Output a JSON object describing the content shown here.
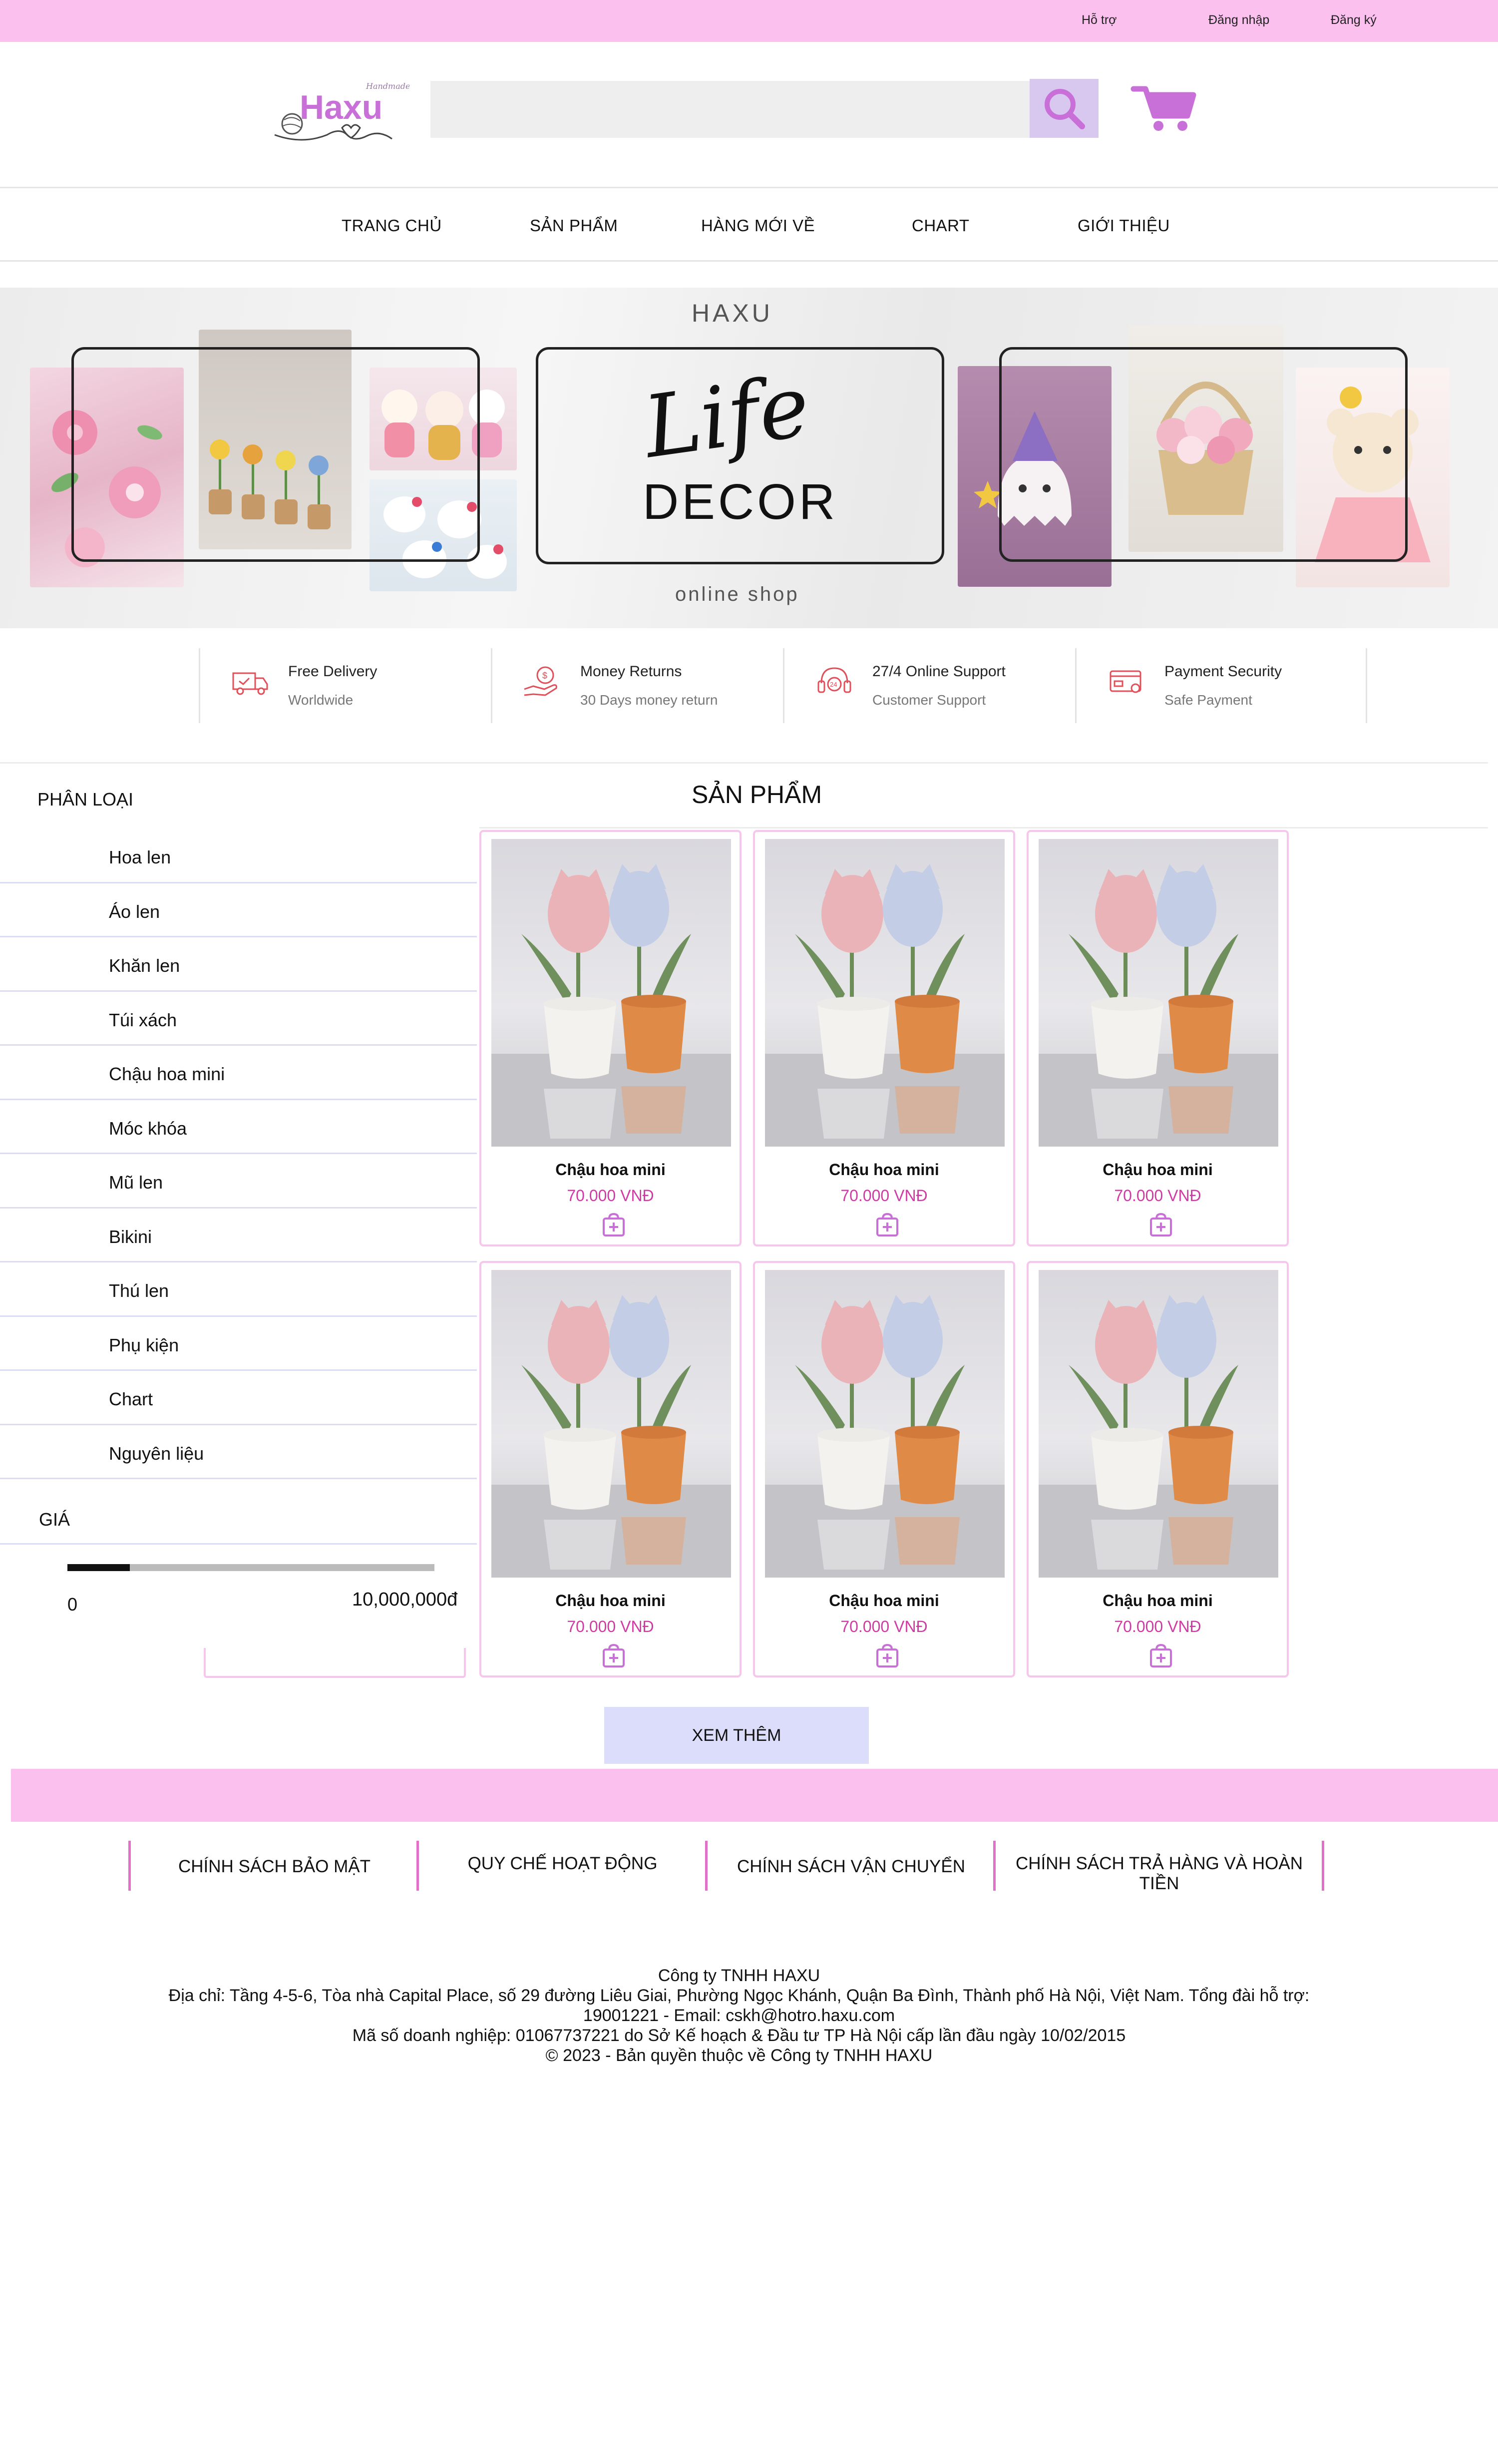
{
  "topbar": {
    "support": "Hỗ trợ",
    "login": "Đăng nhập",
    "register": "Đăng ký"
  },
  "header": {
    "logo_text": "Haxu",
    "logo_script": "Handmade",
    "search_placeholder": ""
  },
  "nav": {
    "items": [
      "TRANG CHỦ",
      "SẢN PHẨM",
      "HÀNG MỚI VỀ",
      "CHART",
      "GIỚI THIỆU"
    ]
  },
  "banner": {
    "brand": "HAXU",
    "headline_script": "Life",
    "headline": "DECOR",
    "tagline": "online shop"
  },
  "features": [
    {
      "title": "Free Delivery",
      "subtitle": "Worldwide",
      "icon": "truck-icon"
    },
    {
      "title": "Money Returns",
      "subtitle": "30 Days money return",
      "icon": "money-hand-icon"
    },
    {
      "title": "27/4 Online Support",
      "subtitle": "Customer Support",
      "icon": "headset-icon"
    },
    {
      "title": "Payment Security",
      "subtitle": "Safe Payment",
      "icon": "credit-card-icon"
    }
  ],
  "sidebar": {
    "title": "PHÂN LOẠI",
    "categories": [
      "Hoa len",
      "Áo len",
      "Khăn len",
      "Túi xách",
      "Chậu hoa mini",
      "Móc khóa",
      "Mũ len",
      "Bikini",
      "Thú len",
      "Phụ kiện",
      "Chart",
      "Nguyên liệu"
    ],
    "price_title": "GIÁ",
    "price_min": "0",
    "price_max": "10,000,000đ",
    "price_slider_fraction": 0.17
  },
  "products": {
    "title": "SẢN PHẨM",
    "items": [
      {
        "name": "Chậu hoa mini",
        "price": "70.000 VNĐ"
      },
      {
        "name": "Chậu hoa mini",
        "price": "70.000 VNĐ"
      },
      {
        "name": "Chậu hoa mini",
        "price": "70.000 VNĐ"
      },
      {
        "name": "Chậu hoa mini",
        "price": "70.000 VNĐ"
      },
      {
        "name": "Chậu hoa mini",
        "price": "70.000 VNĐ"
      },
      {
        "name": "Chậu hoa mini",
        "price": "70.000 VNĐ"
      }
    ],
    "more_label": "XEM THÊM"
  },
  "footer": {
    "policies": [
      "CHÍNH SÁCH BẢO MẬT",
      "QUY CHẾ HOẠT ĐỘNG",
      "CHÍNH SÁCH VẬN CHUYỂN",
      "CHÍNH SÁCH TRẢ HÀNG VÀ HOÀN TIỀN"
    ],
    "company": "Công ty TNHH HAXU",
    "address": "Địa chỉ: Tầng 4-5-6, Tòa nhà Capital Place, số 29 đường Liêu Giai, Phường Ngọc Khánh, Quận Ba Đình, Thành phố Hà Nội, Việt Nam. Tổng đài hỗ trợ:",
    "contact": "19001221 - Email: cskh@hotro.haxu.com",
    "tax": "Mã số doanh nghiệp: 01067737221 do Sở Kế hoạch & Đầu tư TP Hà Nội cấp lần đầu ngày 10/02/2015",
    "copyright": "© 2023 - Bản quyền thuộc về Công ty TNHH HAXU"
  },
  "colors": {
    "accent_pink": "#fcc0ef",
    "price_pink": "#d03aa4",
    "logo_purple": "#c86fd8",
    "search_btn": "#d8c7ee",
    "more_btn": "#dcdcfb"
  }
}
